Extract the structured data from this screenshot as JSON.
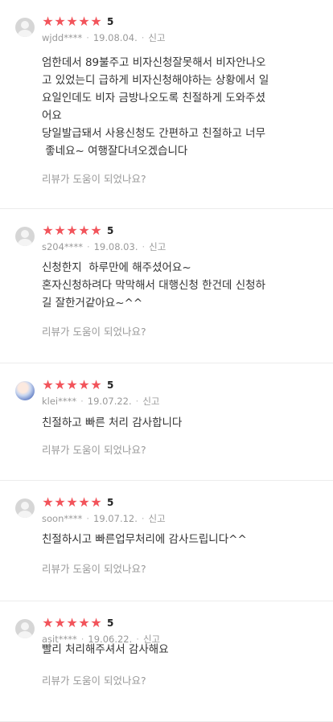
{
  "reviews": [
    {
      "avatar": "default-avatar-icon",
      "rating": "5",
      "user": "wjdd****",
      "date": "19.08.04.",
      "report": "신고",
      "lines": [
        "엄한데서 89불주고 비자신청잘못해서 비자안나오",
        "고 있었는디 급하게 비자신청해야하는 상황에서 일",
        "요일인데도 비자 금방나오도록 친절하게 도와주셨",
        "어요",
        "당일발급돼서 사용신청도 간편하고 친절하고 너무",
        " 좋네요~ 여행잘다녀오겠습니다"
      ],
      "helpful": "리뷰가 도움이 되었나요?"
    },
    {
      "avatar": "default-avatar-icon",
      "rating": "5",
      "user": "s204****",
      "date": "19.08.03.",
      "report": "신고",
      "lines": [
        "신청한지  하루만에 해주셨어요~",
        "혼자신청하려다 막막해서 대행신청 한건데 신청하",
        "길 잘한거같아요~^^"
      ],
      "helpful": "리뷰가 도움이 되었나요?"
    },
    {
      "avatar": "photo-avatar",
      "rating": "5",
      "user": "klei****",
      "date": "19.07.22.",
      "report": "신고",
      "lines": [
        "친절하고 빠른 처리 감사합니다"
      ],
      "helpful": "리뷰가 도움이 되었나요?"
    },
    {
      "avatar": "default-avatar-icon",
      "rating": "5",
      "user": "soon****",
      "date": "19.07.12.",
      "report": "신고",
      "lines": [
        "친절하시고 빠른업무처리에 감사드립니다^^"
      ],
      "helpful": "리뷰가 도움이 되었나요?"
    },
    {
      "avatar": "default-avatar-icon",
      "rating": "5",
      "user": "asit****",
      "date": "19.06.22.",
      "report": "신고",
      "lines": [
        "빨리 처리해주셔서 감사해요"
      ],
      "helpful": "리뷰가 도움이 되었나요?"
    }
  ],
  "colors": {
    "star": "#f2545b",
    "muted": "#999999",
    "divider": "#ececec"
  }
}
